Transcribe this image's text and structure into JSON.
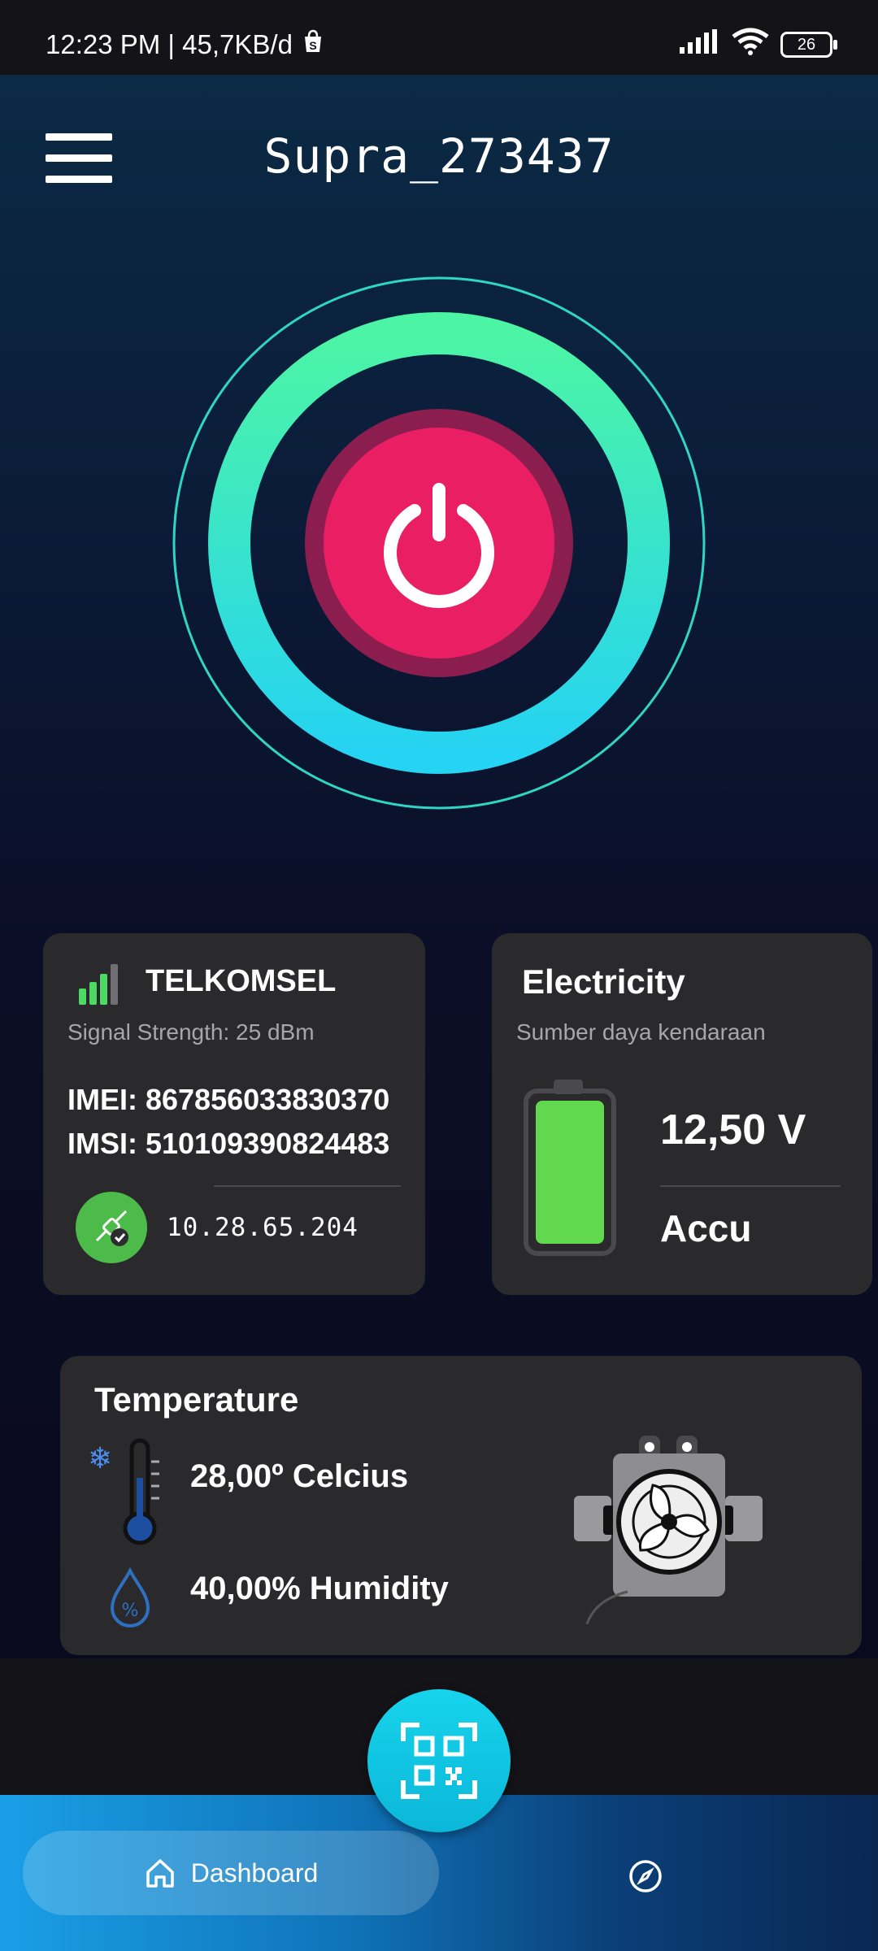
{
  "status_bar": {
    "time_speed": "12:23 PM | 45,7KB/d",
    "battery": "26"
  },
  "header": {
    "title": "Supra_273437"
  },
  "network": {
    "provider": "TELKOMSEL",
    "signal": "Signal Strength: 25 dBm",
    "imei": "IMEI: 867856033830370",
    "imsi": "IMSI: 510109390824483",
    "ip": "10.28.65.204"
  },
  "electricity": {
    "title": "Electricity",
    "subtitle": "Sumber daya kendaraan",
    "voltage": "12,50 V",
    "source": "Accu"
  },
  "temperature": {
    "title": "Temperature",
    "temp": "28,00º Celcius",
    "humidity": "40,00% Humidity"
  },
  "nav": {
    "dashboard": "Dashboard"
  },
  "colors": {
    "accent_green": "#4cf5a4",
    "accent_cyan": "#25d3f2",
    "power_red": "#e91e63",
    "card_bg": "#2a2a2d"
  }
}
